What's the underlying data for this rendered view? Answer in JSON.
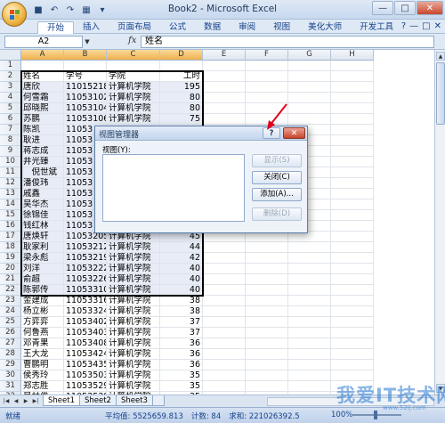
{
  "window": {
    "title": "Book2 - Microsoft Excel",
    "qat_icons": [
      "save-icon",
      "undo-icon",
      "redo-icon",
      "print-preview-icon",
      "customize-icon"
    ],
    "controls": [
      "—",
      "□",
      "✕"
    ]
  },
  "ribbon": {
    "tabs": [
      "开始",
      "插入",
      "页面布局",
      "公式",
      "数据",
      "审阅",
      "视图",
      "美化大师",
      "开发工具"
    ],
    "right_icons": [
      "?",
      "—",
      "□",
      "✕"
    ]
  },
  "formula_bar": {
    "name_box": "A2",
    "fx": "fx",
    "formula": "姓名"
  },
  "columns": [
    "A",
    "B",
    "C",
    "D",
    "E",
    "F",
    "G",
    "H"
  ],
  "rows": [
    {
      "n": "1",
      "a": "",
      "b": "",
      "c": "",
      "d": ""
    },
    {
      "n": "2",
      "a": "姓名",
      "b": "学号",
      "c": "学院",
      "d": "工时"
    },
    {
      "n": "3",
      "a": "唐欣",
      "b": "11015218",
      "c": "计算机学院",
      "d": "195"
    },
    {
      "n": "4",
      "a": "何雪霜",
      "b": "11053102",
      "c": "计算机学院",
      "d": "80"
    },
    {
      "n": "5",
      "a": "邱晓熙",
      "b": "11053104",
      "c": "计算机学院",
      "d": "80"
    },
    {
      "n": "6",
      "a": "苏鹏",
      "b": "11053106",
      "c": "计算机学院",
      "d": "75"
    },
    {
      "n": "7",
      "a": "陈凯",
      "b": "11053",
      "c": "",
      "d": ""
    },
    {
      "n": "8",
      "a": "耿进",
      "b": "11053",
      "c": "",
      "d": ""
    },
    {
      "n": "9",
      "a": "蒋志成",
      "b": "11053",
      "c": "",
      "d": ""
    },
    {
      "n": "10",
      "a": "井光臻",
      "b": "11053",
      "c": "",
      "d": ""
    },
    {
      "n": "11",
      "a": "　倪世斌",
      "b": "11053",
      "c": "",
      "d": ""
    },
    {
      "n": "12",
      "a": "潘俊玮",
      "b": "11053",
      "c": "",
      "d": ""
    },
    {
      "n": "13",
      "a": "戚鑫",
      "b": "11053",
      "c": "",
      "d": ""
    },
    {
      "n": "14",
      "a": "吴华杰",
      "b": "11053",
      "c": "",
      "d": ""
    },
    {
      "n": "15",
      "a": "徐锦佳",
      "b": "11053",
      "c": "",
      "d": ""
    },
    {
      "n": "16",
      "a": "钱红林",
      "b": "11053",
      "c": "",
      "d": ""
    },
    {
      "n": "17",
      "a": "唐焕轩",
      "b": "11053205",
      "c": "计算机学院",
      "d": "45"
    },
    {
      "n": "18",
      "a": "耿家利",
      "b": "11053212",
      "c": "计算机学院",
      "d": "44"
    },
    {
      "n": "19",
      "a": "梁永彪",
      "b": "11053219",
      "c": "计算机学院",
      "d": "42"
    },
    {
      "n": "20",
      "a": "刘洋",
      "b": "11053222",
      "c": "计算机学院",
      "d": "40"
    },
    {
      "n": "21",
      "a": "俞超",
      "b": "11053226",
      "c": "计算机学院",
      "d": "40"
    },
    {
      "n": "22",
      "a": "陈郭传",
      "b": "11053310",
      "c": "计算机学院",
      "d": "40"
    },
    {
      "n": "23",
      "a": "金建成",
      "b": "11053316",
      "c": "计算机学院",
      "d": "38"
    },
    {
      "n": "24",
      "a": "杨立彬",
      "b": "11053324",
      "c": "计算机学院",
      "d": "38"
    },
    {
      "n": "25",
      "a": "方弈弈",
      "b": "11053402",
      "c": "计算机学院",
      "d": "37"
    },
    {
      "n": "26",
      "a": "何鲁燕",
      "b": "11053403",
      "c": "计算机学院",
      "d": "37"
    },
    {
      "n": "27",
      "a": "邓青果",
      "b": "11053408",
      "c": "计算机学院",
      "d": "36"
    },
    {
      "n": "28",
      "a": "王大龙",
      "b": "11053424",
      "c": "计算机学院",
      "d": "36"
    },
    {
      "n": "29",
      "a": "曹鹏明",
      "b": "11053435",
      "c": "计算机学院",
      "d": "36"
    },
    {
      "n": "30",
      "a": "侯秀玲",
      "b": "11053503",
      "c": "计算机学院",
      "d": "35"
    },
    {
      "n": "31",
      "a": "郑志胜",
      "b": "11053529",
      "c": "计算机学院",
      "d": "35"
    },
    {
      "n": "32",
      "a": "吴林俊",
      "b": "11053539",
      "c": "计算机学院",
      "d": "35"
    }
  ],
  "sheets": {
    "tabs": [
      "Sheet1",
      "Sheet2",
      "Sheet3"
    ],
    "active": "Sheet1"
  },
  "status": {
    "ready": "就绪",
    "average": "平均值: 5525659.813",
    "count": "计数: 84",
    "sum": "求和: 221026392.5",
    "zoom": "100%"
  },
  "dialog": {
    "title": "视图管理器",
    "help": "?",
    "close": "✕",
    "list_label": "视图(Y):",
    "buttons": {
      "show": "显示(S)",
      "close": "关闭(C)",
      "add": "添加(A)...",
      "delete": "删除(D)"
    }
  },
  "watermark": {
    "text": "我爱IT技术网",
    "sub": "www.52ij.com"
  }
}
